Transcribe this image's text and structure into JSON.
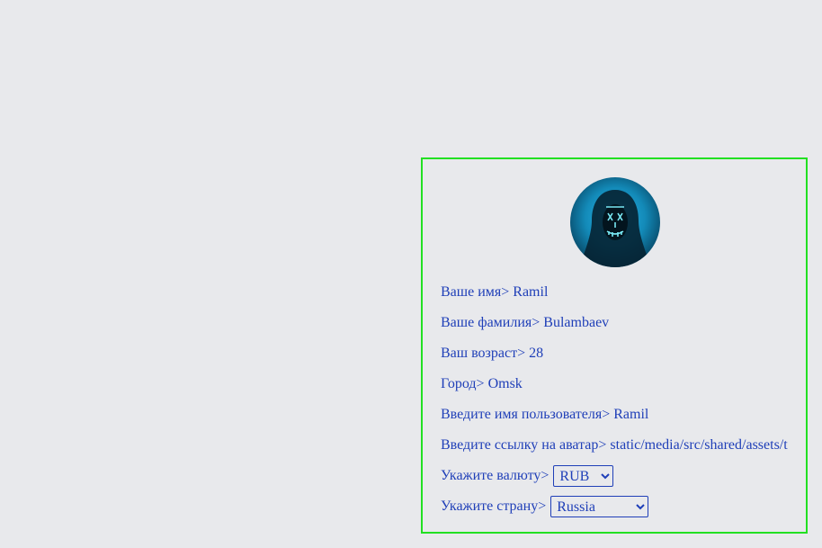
{
  "profile": {
    "fields": [
      {
        "label": "Ваше имя",
        "value": "Ramil"
      },
      {
        "label": "Ваше фамилия",
        "value": "Bulambaev"
      },
      {
        "label": "Ваш возраст",
        "value": "28"
      },
      {
        "label": "Город",
        "value": "Omsk"
      },
      {
        "label": "Введите имя пользователя",
        "value": "Ramil"
      },
      {
        "label": "Введите ссылку на аватар",
        "value": "static/media/src/shared/assets/t"
      }
    ],
    "separator": ">",
    "currency": {
      "label": "Укажите валюту",
      "selected": "RUB"
    },
    "country": {
      "label": "Укажите страну",
      "selected": "Russia"
    }
  },
  "colors": {
    "text": "#1f3fb8",
    "panel_border": "#22e022",
    "background": "#e8e9ec"
  },
  "icons": {
    "avatar": "hooded-figure-neon-mask"
  }
}
